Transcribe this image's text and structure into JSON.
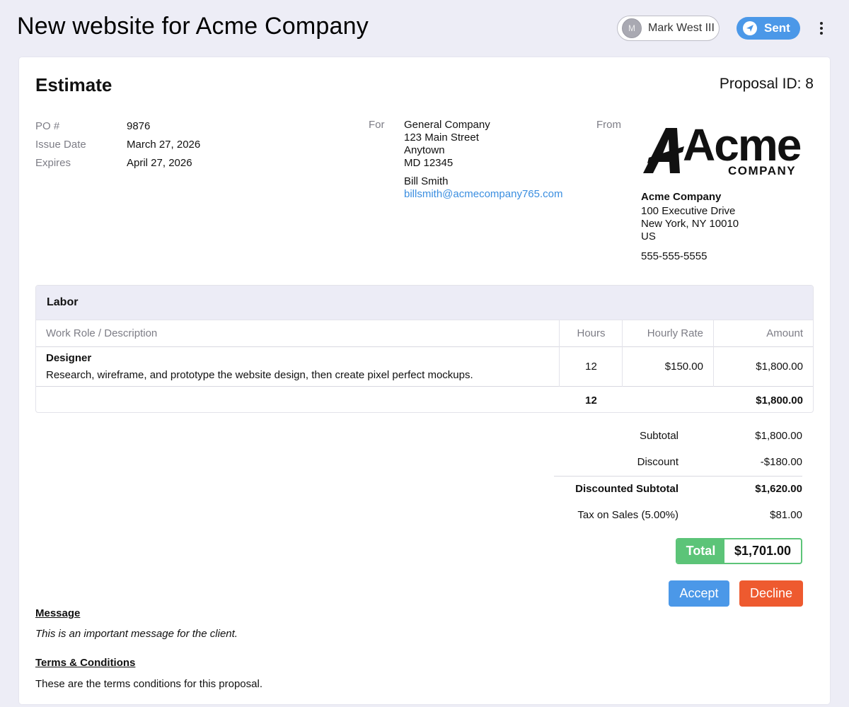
{
  "header": {
    "title": "New website for Acme Company",
    "user": {
      "initial": "M",
      "name": "Mark West III"
    },
    "status": "Sent"
  },
  "estimate": {
    "title": "Estimate",
    "proposal_id": "Proposal ID: 8",
    "meta": [
      {
        "label": "PO #",
        "value": "9876"
      },
      {
        "label": "Issue Date",
        "value": "March 27, 2026"
      },
      {
        "label": "Expires",
        "value": "April 27, 2026"
      }
    ],
    "for": {
      "label": "For",
      "company": "General Company",
      "street": "123 Main Street",
      "city": "Anytown",
      "state_zip": "MD 12345",
      "contact": "Bill Smith",
      "email": "billsmith@acmecompany765.com"
    },
    "from": {
      "label": "From",
      "logo_word": "Acme",
      "logo_sub": "COMPANY",
      "company": "Acme Company",
      "street": "100 Executive Drive",
      "city_state_zip": "New York, NY 10010",
      "country": "US",
      "phone": "555-555-5555"
    }
  },
  "labor": {
    "title": "Labor",
    "columns": [
      "Work Role / Description",
      "Hours",
      "Hourly Rate",
      "Amount"
    ],
    "rows": [
      {
        "role": "Designer",
        "description": "Research, wireframe, and prototype the website design, then create pixel perfect mockups.",
        "hours": "12",
        "rate": "$150.00",
        "amount": "$1,800.00"
      }
    ],
    "totals": {
      "hours": "12",
      "amount": "$1,800.00"
    }
  },
  "summary": {
    "subtotal_label": "Subtotal",
    "subtotal": "$1,800.00",
    "discount_label": "Discount",
    "discount": "-$180.00",
    "discounted_label": "Discounted Subtotal",
    "discounted": "$1,620.00",
    "tax_label": "Tax on Sales (5.00%)",
    "tax": "$81.00",
    "total_label": "Total",
    "total": "$1,701.00"
  },
  "actions": {
    "accept": "Accept",
    "decline": "Decline"
  },
  "message": {
    "heading": "Message",
    "text": "This is an important message for the client."
  },
  "terms": {
    "heading": "Terms & Conditions",
    "text": "These are the terms conditions for this proposal."
  },
  "colors": {
    "accent": "#4b98e8",
    "success": "#5cc478",
    "danger": "#ee5a2f",
    "link": "#3a8ee0"
  }
}
